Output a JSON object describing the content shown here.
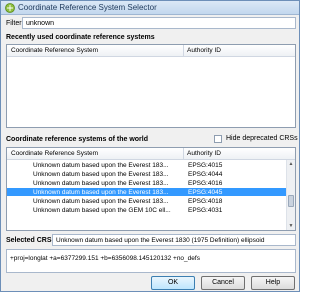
{
  "window": {
    "title": "Coordinate Reference System Selector"
  },
  "filter": {
    "label": "Filter",
    "value": "unknown"
  },
  "recent": {
    "section_label": "Recently used coordinate reference systems",
    "col_crs": "Coordinate Reference System",
    "col_auth": "Authority ID"
  },
  "world": {
    "section_label": "Coordinate reference systems of the world",
    "hide_deprecated_label": "Hide deprecated CRSs",
    "col_crs": "Coordinate Reference System",
    "col_auth": "Authority ID",
    "rows": [
      {
        "crs": "Unknown datum based upon the Everest 183...",
        "auth": "EPSG:4015",
        "selected": false
      },
      {
        "crs": "Unknown datum based upon the Everest 183...",
        "auth": "EPSG:4044",
        "selected": false
      },
      {
        "crs": "Unknown datum based upon the Everest 183...",
        "auth": "EPSG:4016",
        "selected": false
      },
      {
        "crs": "Unknown datum based upon the Everest 183...",
        "auth": "EPSG:4045",
        "selected": true
      },
      {
        "crs": "Unknown datum based upon the Everest 183...",
        "auth": "EPSG:4018",
        "selected": false
      },
      {
        "crs": "Unknown datum based upon the GEM 10C ell...",
        "auth": "EPSG:4031",
        "selected": false
      }
    ]
  },
  "selected_crs": {
    "label": "Selected CRS:",
    "value": "Unknown datum based upon the Everest 1830 (1975 Definition) ellipsoid"
  },
  "proj_string": "+proj=longlat +a=6377299.151 +b=6356098.145120132 +no_defs",
  "buttons": {
    "ok": "OK",
    "cancel": "Cancel",
    "help": "Help"
  },
  "colors": {
    "selection": "#3399ff",
    "title_text": "#1e395b"
  }
}
